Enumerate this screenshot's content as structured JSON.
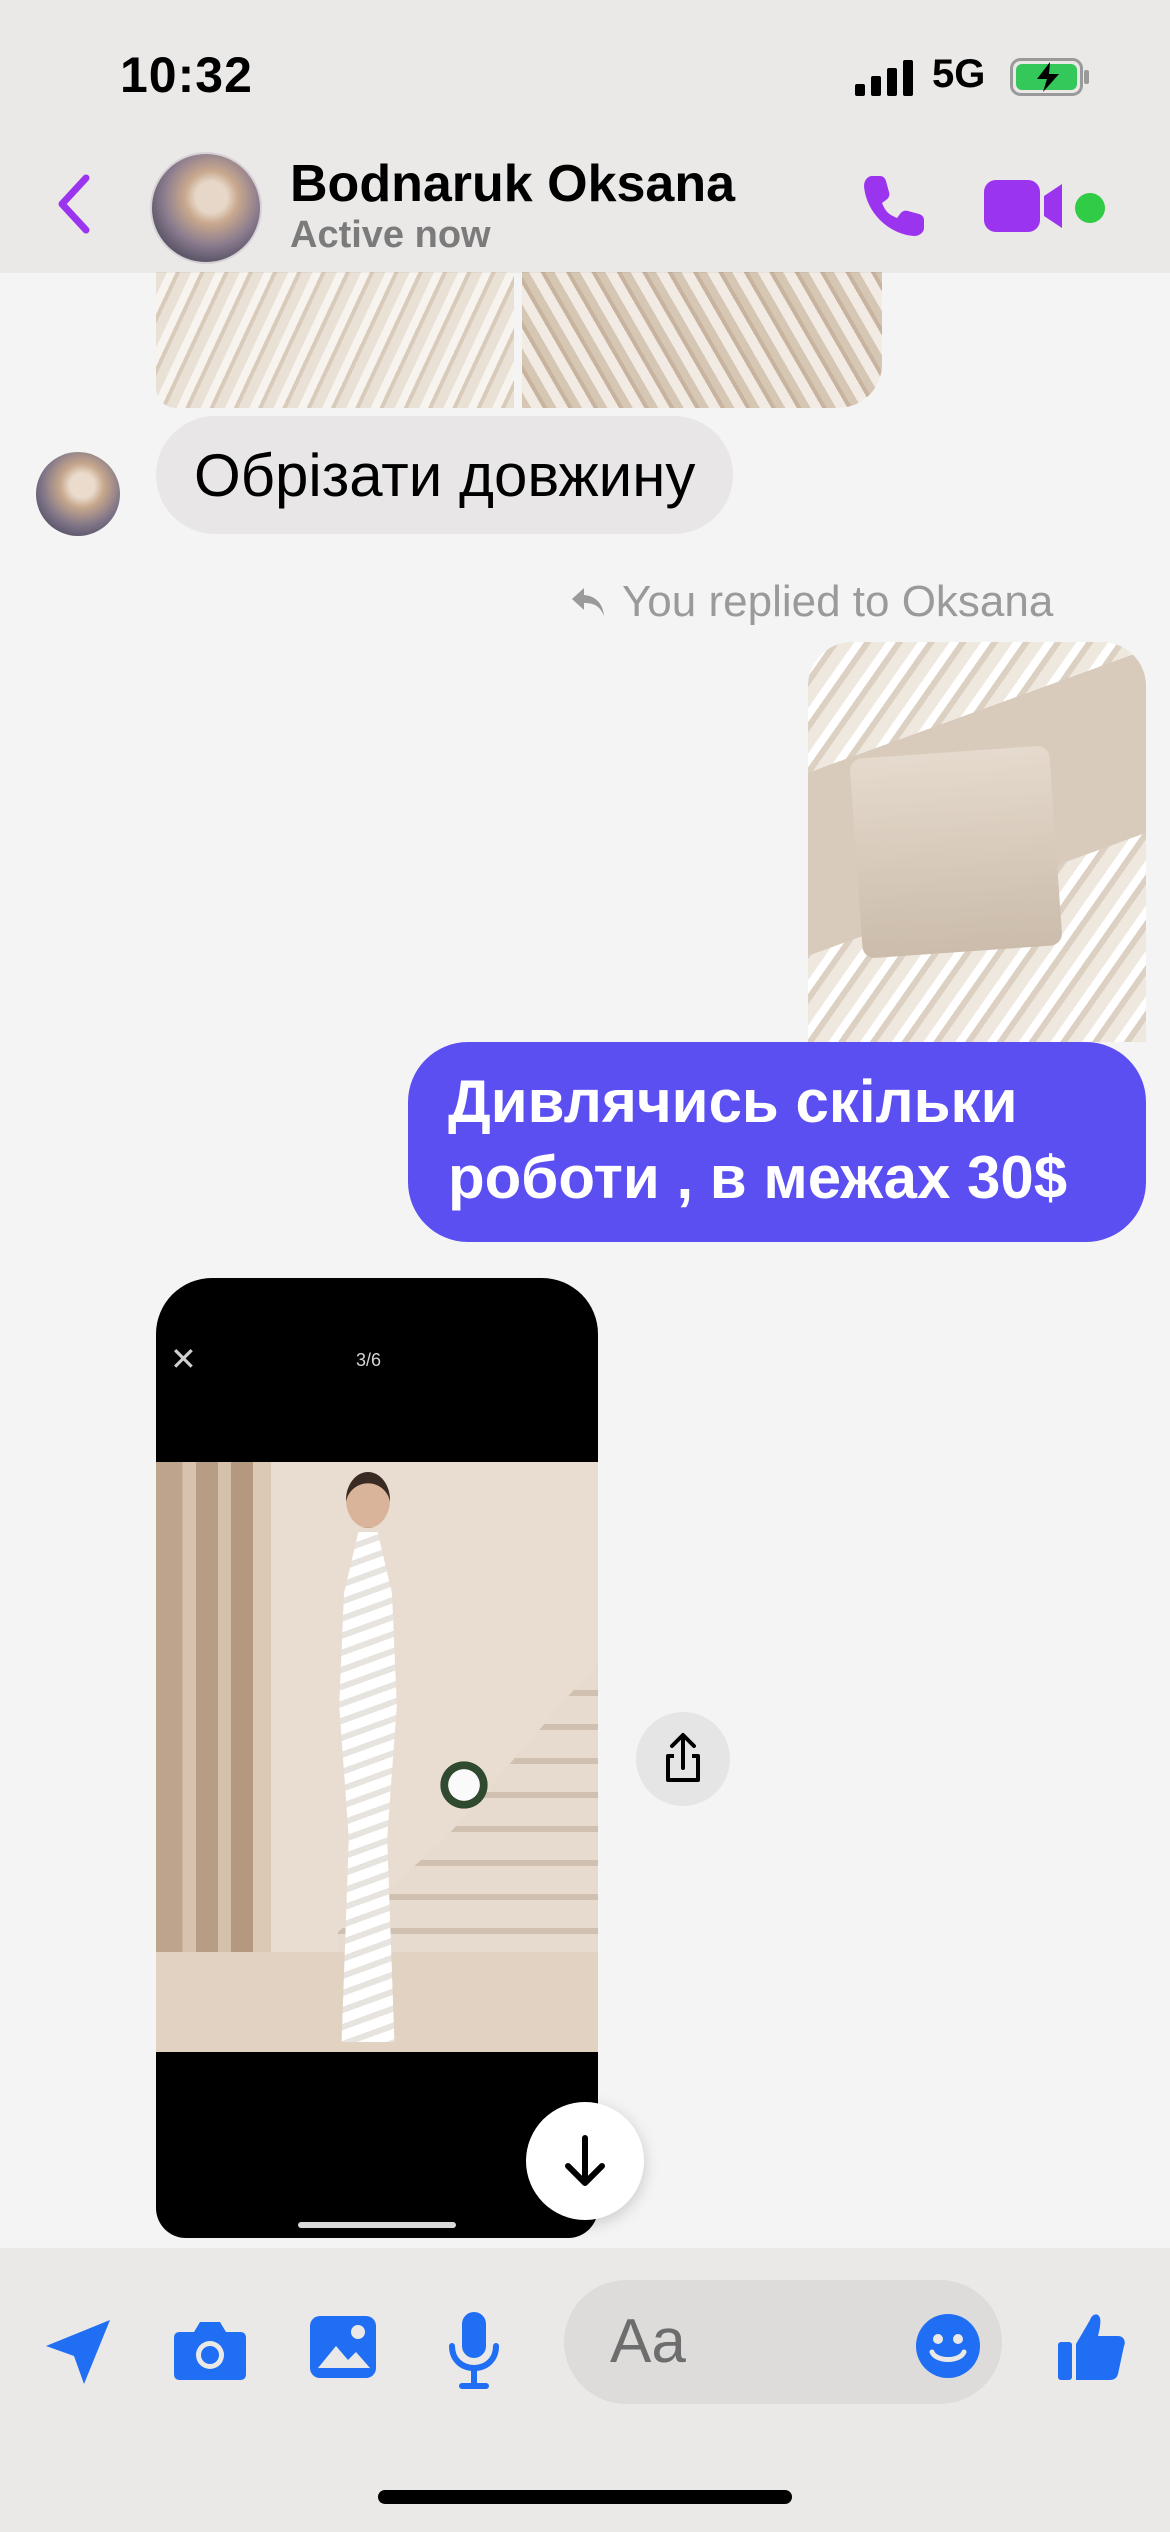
{
  "status_bar": {
    "time": "10:32",
    "network": "5G"
  },
  "header": {
    "contact_name": "Bodnaruk Oksana",
    "status": "Active now",
    "accent_color": "#9b34ef"
  },
  "messages": {
    "incoming_text": "Обрізати довжину",
    "reply_label": "You replied to Oksana",
    "outgoing_line1": "Дивлячись скільки",
    "outgoing_line2": "роботи , в межах 30$",
    "outgoing_color": "#5b4ff2",
    "shared_screenshot": {
      "close_glyph": "✕",
      "counter": "3/6"
    }
  },
  "composer": {
    "placeholder": "Aa",
    "icon_color": "#1f6ef3"
  }
}
